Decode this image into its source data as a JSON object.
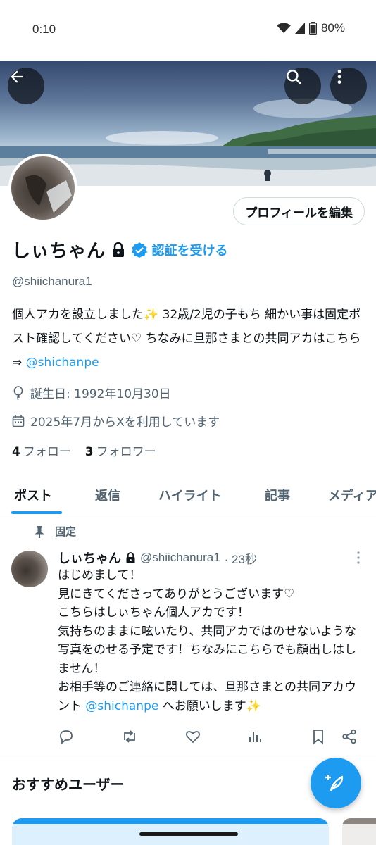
{
  "status_bar": {
    "time": "0:10",
    "battery": "80%"
  },
  "profile": {
    "name": "しぃちゃん",
    "verify_label": "認証を受ける",
    "edit_label": "プロフィールを編集",
    "handle": "@shiichanura1",
    "bio_text": "個人アカを設立しました✨ 32歳/2児の子もち 細かい事は固定ポスト確認してください♡ ちなみに旦那さまとの共同アカはこちら⇒ ",
    "bio_link": "@shichanpe",
    "birthday": "誕生日: 1992年10月30日",
    "joined": "2025年7月からXを利用しています",
    "following_count": "4",
    "following_label": "フォロー",
    "followers_count": "3",
    "followers_label": "フォロワー"
  },
  "tabs": [
    {
      "label": "ポスト"
    },
    {
      "label": "返信"
    },
    {
      "label": "ハイライト"
    },
    {
      "label": "記事"
    },
    {
      "label": "メディア"
    }
  ],
  "pinned_post": {
    "pin_label": "固定",
    "name": "しぃちゃん",
    "handle": "@shiichanura1",
    "time": "· 23秒",
    "text": "はじめまして！\n見にきてくださってありがとうございます♡\nこちらはしぃちゃん個人アカです！\n気持ちのままに呟いたり、共同アカではのせないような写真をのせる予定です！ちなみにこちらでも顔出しはしません！\nお相手等のご連絡に関しては、旦那さまとの共同アカウント ",
    "link": "@shichanpe",
    "text_end": " へお願いします✨"
  },
  "recommended": {
    "title": "おすすめユーザー"
  },
  "colors": {
    "accent": "#1d9bf0",
    "text": "#0f1419",
    "muted": "#536471"
  }
}
